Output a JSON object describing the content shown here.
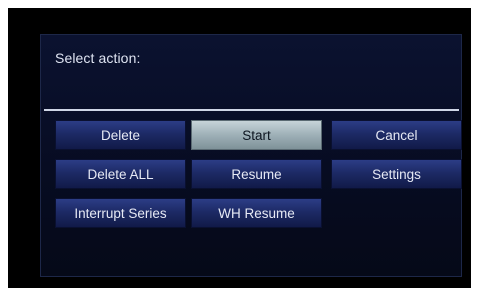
{
  "dialog": {
    "title": "Select action:",
    "selected": "Start",
    "buttons": {
      "delete": "Delete",
      "start": "Start",
      "cancel": "Cancel",
      "delete_all": "Delete ALL",
      "resume": "Resume",
      "settings": "Settings",
      "interrupt_series": "Interrupt Series",
      "wh_resume": "WH Resume"
    }
  },
  "colors": {
    "dialog_background": "#0b1230",
    "button_background": "#1d2a66",
    "selected_button_background": "#9eb0b7",
    "divider": "#cfd6e6",
    "text": "#e6e9f4"
  }
}
